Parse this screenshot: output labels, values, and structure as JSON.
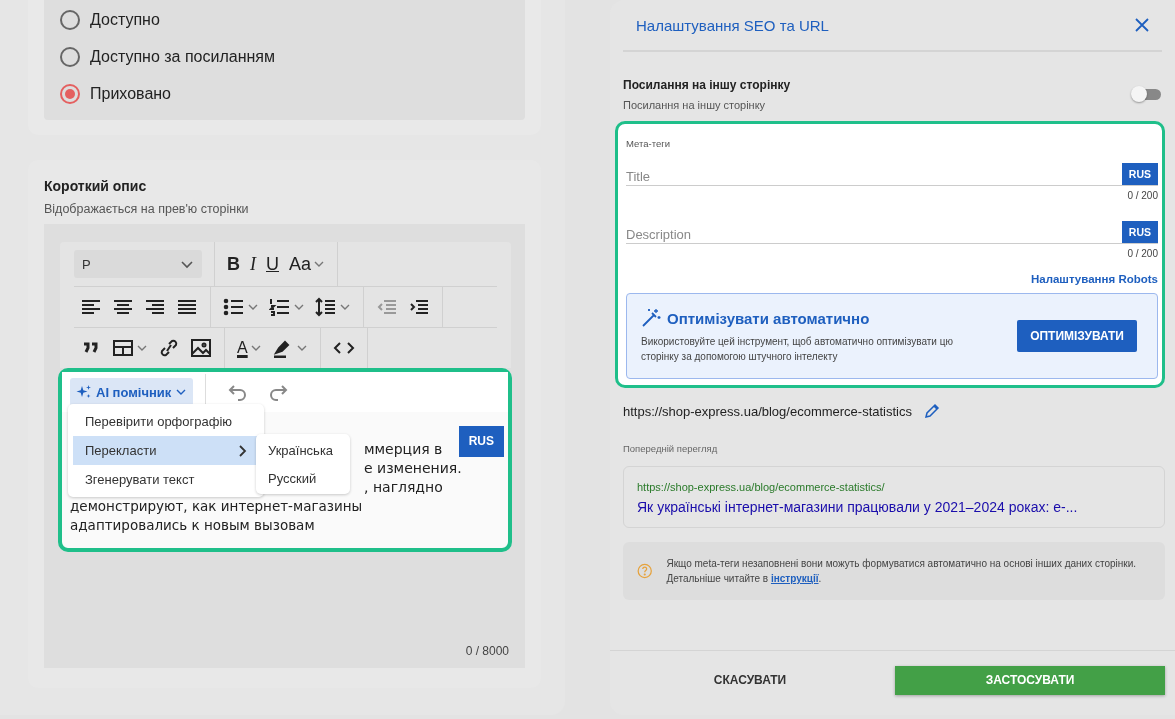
{
  "visibility": {
    "options": [
      {
        "label": "Доступно",
        "selected": false
      },
      {
        "label": "Доступно за посиланням",
        "selected": false
      },
      {
        "label": "Приховано",
        "selected": true
      }
    ]
  },
  "short_description": {
    "title": "Короткий опис",
    "subtitle": "Відображається на прев'ю сторінки",
    "toolbar": [
      [
        [
          {
            "kind": "select",
            "label": "P"
          }
        ],
        [
          {
            "kind": "bold",
            "label": "B"
          },
          {
            "kind": "italic",
            "label": "I"
          },
          {
            "kind": "underline",
            "label": "U"
          },
          {
            "kind": "case",
            "label": "Aa",
            "dropdown": true
          }
        ]
      ],
      [
        [
          {
            "kind": "align-left"
          },
          {
            "kind": "align-center"
          },
          {
            "kind": "align-right"
          },
          {
            "kind": "justify"
          }
        ],
        [
          {
            "kind": "bullets",
            "dropdown": true
          },
          {
            "kind": "numbers",
            "dropdown": true
          },
          {
            "kind": "line-height",
            "dropdown": true
          }
        ],
        [
          {
            "kind": "outdent",
            "disabled": true
          },
          {
            "kind": "indent",
            "disabled": false
          }
        ]
      ],
      [
        [
          {
            "kind": "quote"
          },
          {
            "kind": "table",
            "dropdown": true
          },
          {
            "kind": "link"
          },
          {
            "kind": "image"
          }
        ],
        [
          {
            "kind": "text-color",
            "label": "A",
            "dropdown": true
          },
          {
            "kind": "highlight",
            "dropdown": true
          }
        ],
        [
          {
            "kind": "code"
          }
        ]
      ]
    ],
    "ai_button": {
      "label": "AI помічник"
    },
    "menu": [
      {
        "label": "Перевірити орфографію",
        "selected": false,
        "kind": "action"
      },
      {
        "label": "Перекласти",
        "selected": true,
        "kind": "submenu"
      },
      {
        "label": "Згенерувати текст",
        "selected": false,
        "kind": "action"
      }
    ],
    "submenu": [
      "Українська",
      "Русский"
    ],
    "language": "RUS",
    "text_fragments": [
      "ммерция в",
      "е изменения.",
      ", наглядно"
    ],
    "text_lines": [
      "демонстрируют, как интернет-магазины",
      "адаптировались к новым вызовам"
    ],
    "counter": "0 / 8000"
  },
  "seo_dialog": {
    "title": "Налаштування SEO та URL",
    "redirect": {
      "title": "Посилання на іншу сторінку",
      "subtitle": "Посилання на іншу сторінку",
      "on": false
    },
    "meta_tags": {
      "label": "Мета-теги",
      "fields": [
        {
          "placeholder": "Title",
          "language": "RUS",
          "counter": "0 / 200"
        },
        {
          "placeholder": "Description",
          "language": "RUS",
          "counter": "0 / 200"
        }
      ],
      "robots_link": "Налаштування Robots"
    },
    "optimize": {
      "title": "Оптимізувати автоматично",
      "text": "Використовуйте цей інструмент, щоб автоматично оптимізувати цю сторінку за допомогою штучного інтелекту",
      "button": "ОПТИМІЗУВАТИ"
    },
    "url": "https://shop-express.ua/blog/ecommerce-statistics",
    "preview": {
      "label": "Попередній перегляд",
      "url": "https://shop-express.ua/blog/ecommerce-statistics/",
      "title": "Як українські інтернет-магазини працювали у 2021–2024 роках: e-..."
    },
    "note": {
      "text": "Якщо meta-теги незаповнені вони можуть формуватися автоматично на основі інших даних сторінки. Детальніше читайте в ",
      "link": "інструкції",
      "after": "."
    },
    "buttons": {
      "cancel": "СКАСУВАТИ",
      "apply": "ЗАСТОСУВАТИ"
    }
  }
}
